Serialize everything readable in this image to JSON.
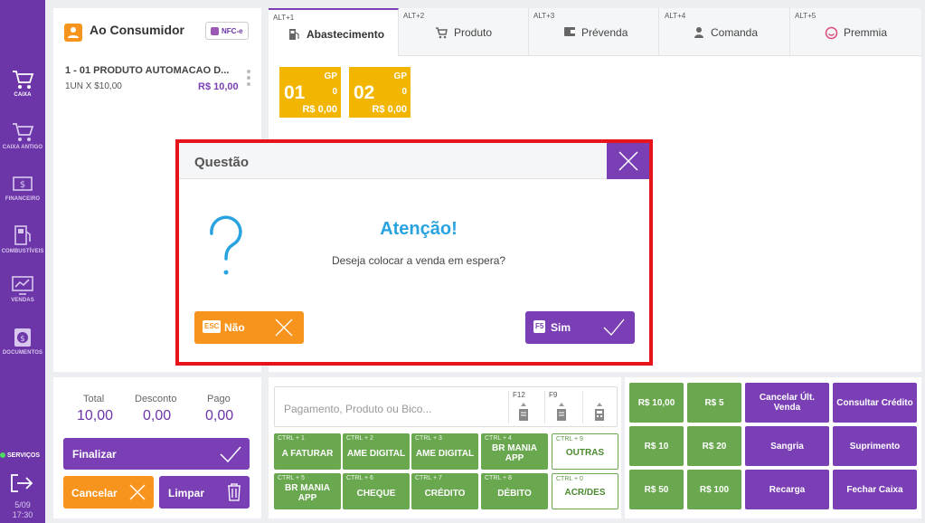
{
  "sidebar": {
    "items": [
      {
        "label": "CAIXA",
        "icon": "cart-icon"
      },
      {
        "label": "CAIXA ANTIGO",
        "icon": "cart-icon"
      },
      {
        "label": "FINANCEIRO",
        "icon": "money-icon"
      },
      {
        "label": "COMBUSTÍVEIS",
        "icon": "fuel-pump-icon"
      },
      {
        "label": "VENDAS",
        "icon": "chart-icon"
      },
      {
        "label": "DOCUMENTOS",
        "icon": "documents-icon"
      }
    ],
    "services_label": "SERVIÇOS",
    "date": "5/09",
    "time": "17:30"
  },
  "customer": {
    "name": "Ao Consumidor",
    "doc_type": "NFC-e"
  },
  "cart": {
    "items": [
      {
        "title": "1 - 01 PRODUTO AUTOMACAO D...",
        "qty": "1UN X $10,00",
        "price": "R$ 10,00"
      }
    ]
  },
  "totals": {
    "total_label": "Total",
    "total_value": "10,00",
    "discount_label": "Desconto",
    "discount_value": "0,00",
    "paid_label": "Pago",
    "paid_value": "0,00"
  },
  "actions": {
    "finalize": "Finalizar",
    "cancel": "Cancelar",
    "clear": "Limpar"
  },
  "tabs": [
    {
      "hotkey": "ALT+1",
      "label": "Abastecimento",
      "icon": "fuel-pump-icon",
      "active": true
    },
    {
      "hotkey": "ALT+2",
      "label": "Produto",
      "icon": "cart-icon"
    },
    {
      "hotkey": "ALT+3",
      "label": "Prévenda",
      "icon": "wallet-icon"
    },
    {
      "hotkey": "ALT+4",
      "label": "Comanda",
      "icon": "user-icon"
    },
    {
      "hotkey": "ALT+5",
      "label": "Premmia",
      "icon": "smile-icon"
    }
  ],
  "pumps": [
    {
      "number": "01",
      "code": "GP",
      "liters": "0",
      "value": "R$ 0,00"
    },
    {
      "number": "02",
      "code": "GP",
      "liters": "0",
      "value": "R$ 0,00"
    }
  ],
  "payment": {
    "search_placeholder": "Pagamento, Produto ou Bico...",
    "f12": "F12",
    "f9": "F9",
    "methods": [
      {
        "ctrl": "CTRL + 1",
        "label": "A FATURAR"
      },
      {
        "ctrl": "CTRL + 2",
        "label": "AME DIGITAL"
      },
      {
        "ctrl": "CTRL + 3",
        "label": "AME DIGITAL"
      },
      {
        "ctrl": "CTRL + 4",
        "label": "BR MANIA APP"
      },
      {
        "ctrl": "CTRL + 9",
        "label": "OUTRAS"
      },
      {
        "ctrl": "CTRL + 5",
        "label": "BR MANIA APP"
      },
      {
        "ctrl": "CTRL + 6",
        "label": "CHEQUE"
      },
      {
        "ctrl": "CTRL + 7",
        "label": "CRÉDITO"
      },
      {
        "ctrl": "CTRL + 8",
        "label": "DÉBITO"
      },
      {
        "ctrl": "CTRL + 0",
        "label": "ACR/DES"
      }
    ]
  },
  "quick": {
    "r10_00": "R$ 10,00",
    "r5": "R$ 5",
    "r10": "R$ 10",
    "r20": "R$ 20",
    "r50": "R$ 50",
    "r100": "R$ 100",
    "cancel_last": "Cancelar Últ. Venda",
    "check_credit": "Consultar Crédito",
    "sangria": "Sangria",
    "suprimento": "Suprimento",
    "recarga": "Recarga",
    "close_cash": "Fechar Caixa"
  },
  "modal": {
    "title": "Questão",
    "heading": "Atenção!",
    "message": "Deseja colocar a venda em espera?",
    "no_key": "ESC",
    "no_label": "Não",
    "yes_key": "F5",
    "yes_label": "Sim"
  },
  "colors": {
    "brand_purple": "#7b3fb5",
    "orange": "#f7941d",
    "green": "#6aa84f",
    "pump_yellow": "#f2b500",
    "highlight_red": "#e8141c",
    "info_blue": "#29a3e0"
  }
}
